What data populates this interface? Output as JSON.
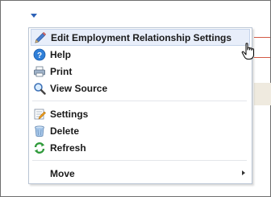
{
  "menu": {
    "items": [
      {
        "id": "edit",
        "label": "Edit Employment Relationship Settings",
        "icon": "pencil-icon"
      },
      {
        "id": "help",
        "label": "Help",
        "icon": "help-icon"
      },
      {
        "id": "print",
        "label": "Print",
        "icon": "print-icon"
      },
      {
        "id": "view_source",
        "label": "View Source",
        "icon": "magnifier-icon"
      },
      {
        "id": "settings",
        "label": "Settings",
        "icon": "settings-icon"
      },
      {
        "id": "delete",
        "label": "Delete",
        "icon": "trash-icon"
      },
      {
        "id": "refresh",
        "label": "Refresh",
        "icon": "refresh-icon"
      },
      {
        "id": "move",
        "label": "Move",
        "icon": "",
        "submenu": true
      }
    ]
  },
  "colors": {
    "accent": "#2d62b7",
    "hover_bg": "#e8eefa",
    "background_rule": "#d25a45"
  }
}
